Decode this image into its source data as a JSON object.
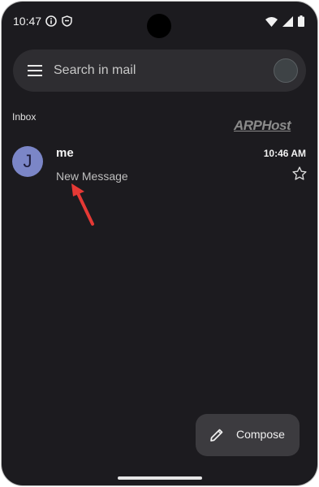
{
  "status_bar": {
    "time": "10:47",
    "icons": [
      "info-icon",
      "shield-icon",
      "wifi-icon",
      "signal-icon",
      "battery-icon"
    ]
  },
  "search": {
    "placeholder": "Search in mail",
    "menu_icon": "menu-icon",
    "avatar_icon": "account-avatar"
  },
  "inbox": {
    "label": "Inbox",
    "watermark": "ARPHost",
    "messages": [
      {
        "avatar_initial": "J",
        "avatar_color": "#7b86c7",
        "sender": "me",
        "time": "10:46 AM",
        "subject": "New Message",
        "starred": false
      }
    ]
  },
  "annotation": {
    "arrow_color": "#e53935"
  },
  "compose": {
    "label": "Compose",
    "icon": "pencil-icon"
  }
}
